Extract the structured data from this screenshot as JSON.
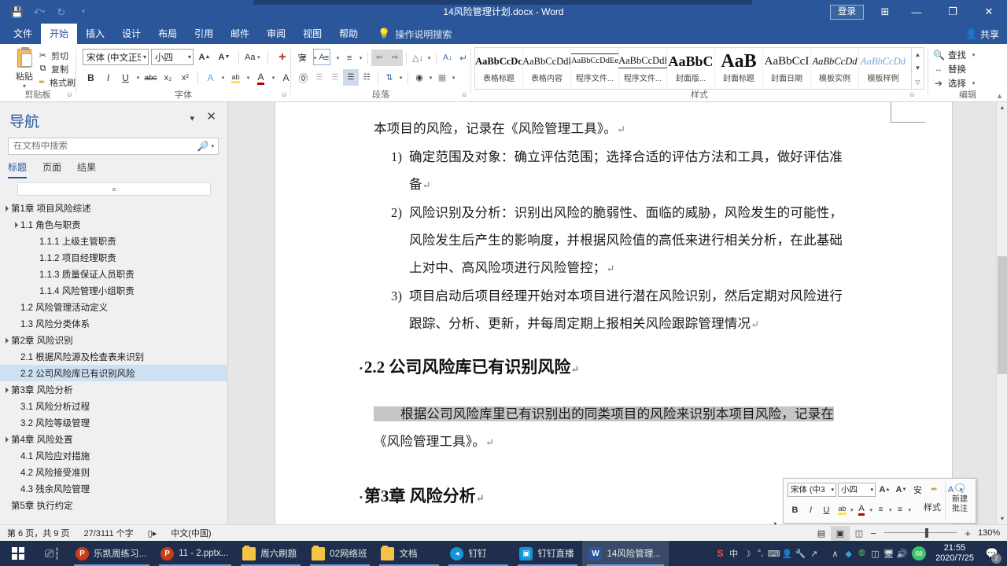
{
  "titlebar": {
    "document_title": "14风险管理计划.docx  -  Word",
    "quick_access": [
      {
        "name": "save-icon",
        "glyph": "ὋE"
      },
      {
        "name": "undo-icon",
        "glyph": "↶"
      },
      {
        "name": "redo-icon",
        "glyph": "↻"
      },
      {
        "name": "customize-qat-icon",
        "glyph": "▾"
      }
    ],
    "login_label": "登录",
    "ribbon_display_icon": "⬜",
    "minimize_icon": "─",
    "restore_icon": "❐",
    "close_icon": "✕",
    "share_label": "共享"
  },
  "tabs": [
    {
      "label": "文件",
      "active": false
    },
    {
      "label": "开始",
      "active": true
    },
    {
      "label": "插入",
      "active": false
    },
    {
      "label": "设计",
      "active": false
    },
    {
      "label": "布局",
      "active": false
    },
    {
      "label": "引用",
      "active": false
    },
    {
      "label": "邮件",
      "active": false
    },
    {
      "label": "审阅",
      "active": false
    },
    {
      "label": "视图",
      "active": false
    },
    {
      "label": "帮助",
      "active": false
    }
  ],
  "tell_me": "操作说明搜索",
  "ribbon": {
    "groups": [
      {
        "name": "clipboard",
        "label": "剪贴板"
      },
      {
        "name": "font",
        "label": "字体"
      },
      {
        "name": "paragraph",
        "label": "段落"
      },
      {
        "name": "styles",
        "label": "样式"
      },
      {
        "name": "editing",
        "label": "编辑"
      }
    ],
    "clipboard": {
      "paste_label": "粘贴",
      "items": [
        {
          "label": "剪切",
          "icon": "✂"
        },
        {
          "label": "复制",
          "icon": "⧉"
        },
        {
          "label": "格式刷",
          "icon": "✒"
        }
      ]
    },
    "font": {
      "font_name": "宋体 (中文正5",
      "font_size": "小四",
      "grow_font": "A",
      "shrink_font": "A",
      "change_case": "Aa",
      "clear_format": "✐",
      "phonetic": "安",
      "char_border": "A",
      "bold": "B",
      "italic": "I",
      "underline": "U",
      "strikethrough": "abc",
      "subscript": "x₂",
      "superscript": "x²",
      "text_effects": "A",
      "highlight": "ab",
      "font_color": "A",
      "char_shading": "A",
      "enclose_char": "ⓐ"
    },
    "paragraph": {
      "bullets": "≡",
      "numbering": "≡",
      "multilevel": "≡",
      "decrease_indent": "⬅",
      "increase_indent": "➡",
      "sort": "A↓",
      "show_marks": "¶",
      "align_left": "≡",
      "align_center": "≡",
      "align_right": "≡",
      "justify": "≡",
      "distribute": "≡",
      "line_spacing": "↕",
      "shading": "▲",
      "borders": "⊞"
    },
    "styles": [
      {
        "preview": "AaBbCcDc",
        "name": "表格标题"
      },
      {
        "preview": "AaBbCcDdl",
        "name": "表格内容"
      },
      {
        "preview": "AaBbCcDdEe",
        "name": "程序文件..."
      },
      {
        "preview": "AaBbCcDdl",
        "name": "程序文件..."
      },
      {
        "preview": "AaBbC",
        "name": "封面版..."
      },
      {
        "preview": "AaB",
        "name": "封面标题"
      },
      {
        "preview": "AaBbCcI",
        "name": "封面日期"
      },
      {
        "preview": "AaBbCcDd",
        "name": "模板实例"
      },
      {
        "preview": "AaBbCcDd",
        "name": "模板样例"
      }
    ],
    "editing": [
      {
        "label": "查找",
        "icon": "ὐD",
        "has_arrow": true
      },
      {
        "label": "替换",
        "icon": "ab",
        "has_arrow": false
      },
      {
        "label": "选择",
        "icon": "↖",
        "has_arrow": true
      }
    ]
  },
  "navigation": {
    "title": "导航",
    "dropdown_icon": "▼",
    "close_icon": "✕",
    "search_placeholder": "在文档中搜索",
    "search_value": "",
    "search_icon": "ὐE",
    "tabs": [
      {
        "label": "标题",
        "active": true
      },
      {
        "label": "页面",
        "active": false
      },
      {
        "label": "结果",
        "active": false
      }
    ],
    "headings": [
      {
        "label": "第1章 项目风险综述",
        "level": 1,
        "expandable": true,
        "selected": false
      },
      {
        "label": "1.1 角色与职责",
        "level": 2,
        "expandable": true,
        "selected": false
      },
      {
        "label": "1.1.1 上级主管职责",
        "level": 3,
        "expandable": false,
        "selected": false
      },
      {
        "label": "1.1.2 项目经理职责",
        "level": 3,
        "expandable": false,
        "selected": false
      },
      {
        "label": "1.1.3 质量保证人员职责",
        "level": 3,
        "expandable": false,
        "selected": false
      },
      {
        "label": "1.1.4 风险管理小组职责",
        "level": 3,
        "expandable": false,
        "selected": false
      },
      {
        "label": "1.2 风险管理活动定义",
        "level": 2,
        "expandable": false,
        "selected": false
      },
      {
        "label": "1.3 风险分类体系",
        "level": 2,
        "expandable": false,
        "selected": false
      },
      {
        "label": "第2章 风险识别",
        "level": 1,
        "expandable": true,
        "selected": false
      },
      {
        "label": "2.1 根据风险源及检查表来识别",
        "level": 2,
        "expandable": false,
        "selected": false
      },
      {
        "label": "2.2 公司风险库已有识别风险",
        "level": 2,
        "expandable": false,
        "selected": true
      },
      {
        "label": "第3章 风险分析",
        "level": 1,
        "expandable": true,
        "selected": false
      },
      {
        "label": "3.1 风险分析过程",
        "level": 2,
        "expandable": false,
        "selected": false
      },
      {
        "label": "3.2 风险等级管理",
        "level": 2,
        "expandable": false,
        "selected": false
      },
      {
        "label": "第4章 风险处置",
        "level": 1,
        "expandable": true,
        "selected": false
      },
      {
        "label": "4.1 风险应对措施",
        "level": 2,
        "expandable": false,
        "selected": false
      },
      {
        "label": "4.2 风险接受准则",
        "level": 2,
        "expandable": false,
        "selected": false
      },
      {
        "label": "4.3 残余风险管理",
        "level": 2,
        "expandable": false,
        "selected": false
      },
      {
        "label": "第5章 执行约定",
        "level": 1,
        "expandable": false,
        "selected": false
      }
    ]
  },
  "document": {
    "paragraph_1": "本项目的风险，记录在《风险管理工具》。",
    "list": [
      {
        "num": "1)",
        "text": "确定范围及对象：确立评估范围；选择合适的评估方法和工具，做好评估准备"
      },
      {
        "num": "2)",
        "text": "风险识别及分析：识别出风险的脆弱性、面临的威胁，风险发生的可能性，风险发生后产生的影响度，并根据风险值的高低来进行相关分析，在此基础上对中、高风险项进行风险管控；"
      },
      {
        "num": "3)",
        "text": "项目启动后项目经理开始对本项目进行潜在风险识别，然后定期对风险进行跟踪、分析、更新，并每周定期上报相关风险跟踪管理情况"
      }
    ],
    "heading_2_2": "2.2 公司风险库已有识别风险",
    "paragraph_2_selected": "根据公司风险库里已有识别出的同类项目的风险来识别本项目风险，记录在",
    "paragraph_2_rest": "《风险管理工具》。",
    "heading_ch3": "第3章 风险分析",
    "pilcrow": "↵"
  },
  "mini_toolbar": {
    "font_name": "宋体 (中3",
    "font_size": "小四",
    "grow_font": "A",
    "shrink_font": "A",
    "phonetic": "安",
    "format_painter": "✒",
    "text_effects": "A",
    "bold": "B",
    "italic": "I",
    "underline": "U",
    "highlight": "ab",
    "font_color": "A",
    "bullets": "≡",
    "numbering": "≡",
    "styles_label": "样式",
    "new_comment_line1": "新建",
    "new_comment_line2": "批注",
    "comment_icon": "ὊC"
  },
  "statusbar": {
    "page_info": "第 6 页，共 9 页",
    "word_count": "27/3111 个字",
    "proofing_icon": "Ὅ6",
    "language": "中文(中国)",
    "views": [
      {
        "name": "read-mode",
        "icon": "Ὅ6",
        "active": false
      },
      {
        "name": "print-layout",
        "icon": "■",
        "active": true
      },
      {
        "name": "web-layout",
        "icon": "὜E",
        "active": false
      }
    ],
    "zoom_out": "−",
    "zoom_in": "+",
    "zoom_level": "130%"
  },
  "taskbar": {
    "start_icon": "windows-logo",
    "task_view_icon": "Ὕ4",
    "apps": [
      {
        "label": "乐凯周练习...",
        "icon": "P",
        "type": "ppt",
        "active": false
      },
      {
        "label": "11 - 2.pptx...",
        "icon": "P",
        "type": "ppt",
        "active": false
      },
      {
        "label": "周六刷题",
        "icon": "",
        "type": "folder",
        "active": false
      },
      {
        "label": "02网络班",
        "icon": "",
        "type": "folder",
        "active": false
      },
      {
        "label": "文档",
        "icon": "",
        "type": "folder",
        "active": false
      },
      {
        "label": "钉钉",
        "icon": "◆",
        "type": "dingtalk",
        "active": false
      },
      {
        "label": "钉钉直播",
        "icon": "▣",
        "type": "dingtalk-live",
        "active": false
      },
      {
        "label": "14风险管理...",
        "icon": "W",
        "type": "word",
        "active": true
      }
    ],
    "tray": [
      {
        "name": "sogou-ime-icon",
        "glyph": "S"
      },
      {
        "name": "ime-chinese-icon",
        "glyph": "中"
      },
      {
        "name": "ime-moon-icon",
        "glyph": "☽"
      },
      {
        "name": "ime-punctuation-icon",
        "glyph": "°,"
      },
      {
        "name": "ime-keyboard-icon",
        "glyph": "⌨"
      },
      {
        "name": "ime-user-icon",
        "glyph": "὆4"
      },
      {
        "name": "ime-tools-icon",
        "glyph": "ὒ7"
      },
      {
        "name": "ime-expand-icon",
        "glyph": "↗"
      },
      {
        "name": "show-hidden-icons",
        "glyph": "∧"
      },
      {
        "name": "dingtalk-tray-icon",
        "glyph": "◆"
      },
      {
        "name": "update-tray-icon",
        "glyph": "↑"
      },
      {
        "name": "battery-tray-icon",
        "glyph": "ὐB"
      },
      {
        "name": "display-tray-icon",
        "glyph": "Ὓ5"
      },
      {
        "name": "volume-tray-icon",
        "glyph": "ὐA"
      }
    ],
    "battery_percent": "68",
    "time": "21:55",
    "date": "2020/7/25",
    "notification_count": "2",
    "notification_icon": "὚5"
  }
}
